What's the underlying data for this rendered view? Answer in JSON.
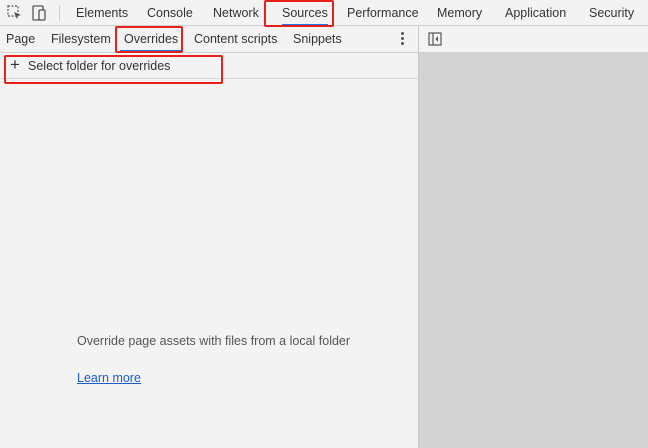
{
  "toolbar": {
    "icons": [
      "inspect-element-icon",
      "device-toolbar-icon"
    ],
    "tabs": [
      {
        "label": "Elements"
      },
      {
        "label": "Console"
      },
      {
        "label": "Network"
      },
      {
        "label": "Sources",
        "selected": true
      },
      {
        "label": "Performance"
      },
      {
        "label": "Memory"
      },
      {
        "label": "Application"
      },
      {
        "label": "Security"
      }
    ]
  },
  "navigator": {
    "tabs": [
      {
        "label": "Page"
      },
      {
        "label": "Filesystem"
      },
      {
        "label": "Overrides",
        "selected": true
      },
      {
        "label": "Content scripts"
      },
      {
        "label": "Snippets"
      }
    ],
    "more_icon": "more-vertical-icon",
    "select_folder": {
      "icon": "plus-icon",
      "label": "Select folder for overrides"
    },
    "empty_message": "Override page assets with files from a local folder",
    "learn_more": "Learn more"
  },
  "editor": {
    "toggle_icon": "toggle-navigator-icon"
  },
  "colors": {
    "accent": "#1a73e8",
    "highlight": "#e8201a",
    "panel_bg": "#f3f3f3",
    "editor_bg": "#d3d3d3",
    "link": "#1a5fc7"
  }
}
